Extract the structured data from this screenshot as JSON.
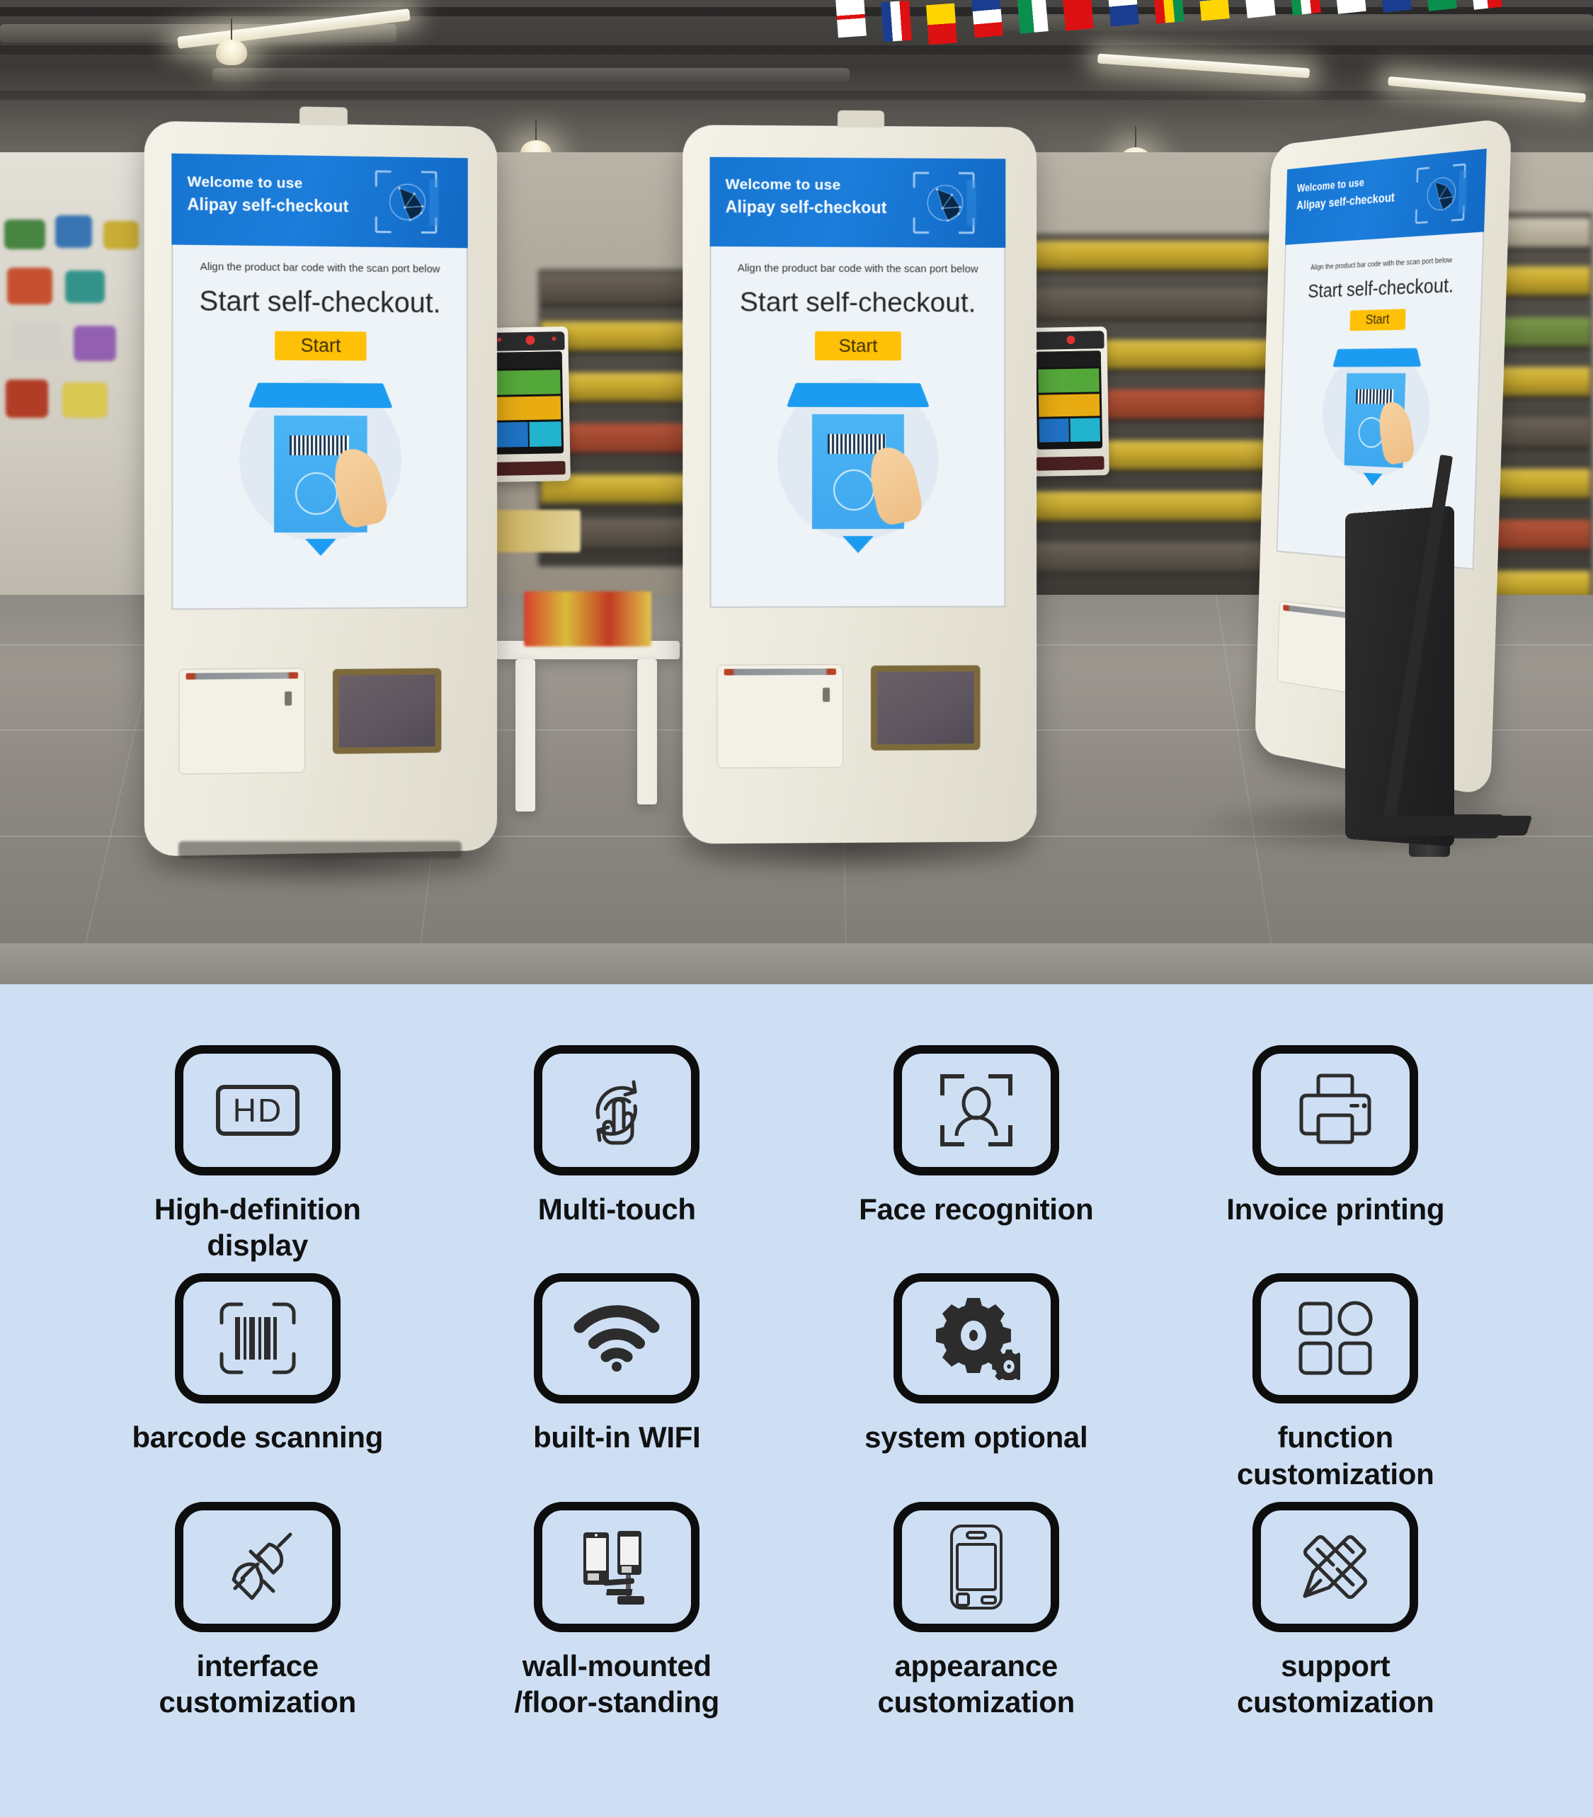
{
  "scene": {
    "title": "Alipay self-checkout kiosk showroom photo",
    "kiosks": [
      {
        "id": "kiosk-left",
        "screen": {
          "header_line1": "Welcome to use",
          "header_line2": "Alipay self-checkout",
          "align_text": "Align the product bar code with the scan port below",
          "start_title": "Start self-checkout.",
          "start_button": "Start"
        }
      },
      {
        "id": "kiosk-center",
        "screen": {
          "header_line1": "Welcome to use",
          "header_line2": "Alipay self-checkout",
          "align_text": "Align the product bar code with the scan port below",
          "start_title": "Start self-checkout.",
          "start_button": "Start"
        }
      },
      {
        "id": "kiosk-right",
        "screen": {
          "header_line1": "Welcome to use",
          "header_line2": "Alipay self-checkout",
          "align_text": "Align the product bar code with the scan port below",
          "start_title": "Start self-checkout.",
          "start_button": "Start"
        }
      }
    ],
    "colors": {
      "header_blue": "#1675d1",
      "start_button": "#ffc107",
      "kiosk_shell": "#f0ede2",
      "illustration_blue": "#3ea7ef"
    }
  },
  "features": {
    "background_color": "#cedff4",
    "items": [
      {
        "icon": "hd-display-icon",
        "label": "High-definition\ndisplay"
      },
      {
        "icon": "multi-touch-icon",
        "label": "Multi-touch"
      },
      {
        "icon": "face-recognition-icon",
        "label": "Face recognition"
      },
      {
        "icon": "invoice-printer-icon",
        "label": "Invoice printing"
      },
      {
        "icon": "barcode-scan-icon",
        "label": "barcode scanning"
      },
      {
        "icon": "wifi-icon",
        "label": "built-in WIFI"
      },
      {
        "icon": "gears-icon",
        "label": "system optional"
      },
      {
        "icon": "function-grid-icon",
        "label": "function\ncustomization"
      },
      {
        "icon": "plug-connector-icon",
        "label": "interface\ncustomization"
      },
      {
        "icon": "mount-options-icon",
        "label": "wall-mounted\n/floor-standing"
      },
      {
        "icon": "device-outline-icon",
        "label": "appearance\ncustomization"
      },
      {
        "icon": "pencil-ruler-icon",
        "label": "support\ncustomization"
      }
    ]
  }
}
